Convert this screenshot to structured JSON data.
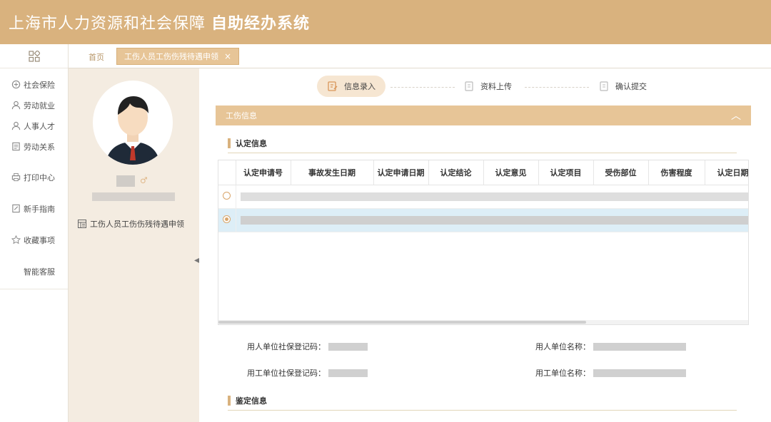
{
  "header": {
    "title_part1": "上海市人力资源和社会保障",
    "title_part2": "自助经办系统"
  },
  "leftnav": {
    "items": [
      {
        "label": "社会保险",
        "icon": "shield-icon"
      },
      {
        "label": "劳动就业",
        "icon": "person-badge-icon"
      },
      {
        "label": "人事人才",
        "icon": "person-icon"
      },
      {
        "label": "劳动关系",
        "icon": "document-icon"
      },
      {
        "label": "打印中心",
        "icon": "printer-icon"
      },
      {
        "label": "新手指南",
        "icon": "guide-icon"
      },
      {
        "label": "收藏事项",
        "icon": "star-icon"
      },
      {
        "label": "智能客服",
        "icon": ""
      }
    ]
  },
  "tabs": {
    "home": "首页",
    "active": "工伤人员工伤伤残待遇申领",
    "close": "×"
  },
  "profile": {
    "gender_symbol": "♂",
    "task_label": "工伤人员工伤伤残待遇申领"
  },
  "steps": [
    {
      "label": "信息录入",
      "state": "active"
    },
    {
      "label": "资料上传",
      "state": "pending"
    },
    {
      "label": "确认提交",
      "state": "pending"
    }
  ],
  "section": {
    "title": "工伤信息"
  },
  "recognition": {
    "title": "认定信息",
    "columns": [
      "认定申请号",
      "事故发生日期",
      "认定申请日期",
      "认定结论",
      "认定意见",
      "认定项目",
      "受伤部位",
      "伤害程度",
      "认定日期"
    ]
  },
  "fields": {
    "employer_code_label": "用人单位社保登记码：",
    "employer_name_label": "用人单位名称：",
    "work_unit_code_label": "用工单位社保登记码：",
    "work_unit_name_label": "用工单位名称："
  },
  "appraisal": {
    "title": "鉴定信息"
  },
  "colors": {
    "brand": "#d9b27e",
    "section": "#e7c597",
    "selected_row": "#ddeef7"
  }
}
